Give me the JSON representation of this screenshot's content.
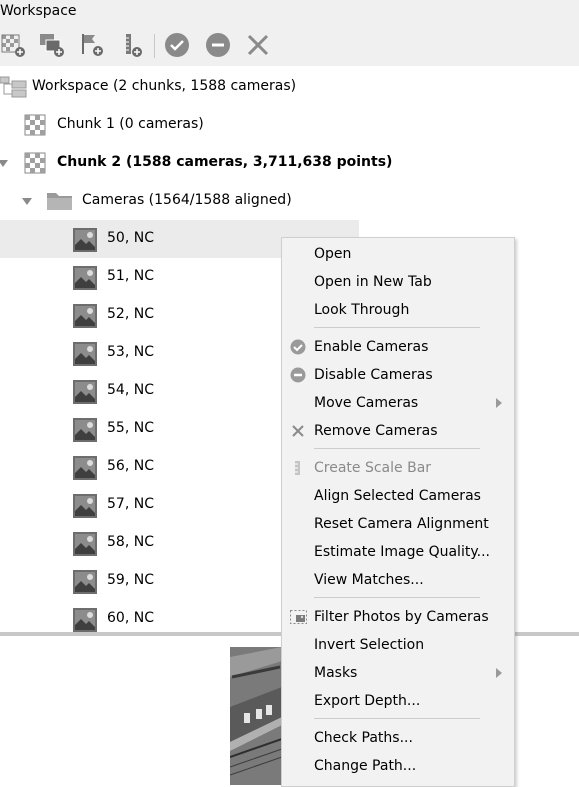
{
  "panel": {
    "title": "Workspace"
  },
  "toolbar": {
    "buttons": [
      {
        "icon": "add-chunk-icon"
      },
      {
        "icon": "add-photos-icon"
      },
      {
        "icon": "add-markers-icon"
      },
      {
        "icon": "add-scalebar-icon"
      },
      {
        "icon": "enable-check-icon"
      },
      {
        "icon": "disable-minus-icon"
      },
      {
        "icon": "remove-x-icon"
      }
    ]
  },
  "tree": {
    "workspace": "Workspace (2 chunks, 1588 cameras)",
    "chunk1": "Chunk 1 (0 cameras)",
    "chunk2": "Chunk 2 (1588 cameras, 3,711,638 points)",
    "cameras_folder": "Cameras (1564/1588 aligned)",
    "cameras": [
      "50, NC",
      "51, NC",
      "52, NC",
      "53, NC",
      "54, NC",
      "55, NC",
      "56, NC",
      "57, NC",
      "58, NC",
      "59, NC",
      "60, NC"
    ]
  },
  "context_menu": {
    "open": "Open",
    "open_new_tab": "Open in New Tab",
    "look_through": "Look Through",
    "enable_cameras": "Enable Cameras",
    "disable_cameras": "Disable Cameras",
    "move_cameras": "Move Cameras",
    "remove_cameras": "Remove Cameras",
    "create_scale_bar": "Create Scale Bar",
    "align_selected": "Align Selected Cameras",
    "reset_alignment": "Reset Camera Alignment",
    "estimate_quality": "Estimate Image Quality...",
    "view_matches": "View Matches...",
    "filter_photos": "Filter Photos by Cameras",
    "invert_selection": "Invert Selection",
    "masks": "Masks",
    "export_depth": "Export Depth...",
    "check_paths": "Check Paths...",
    "change_path": "Change Path..."
  },
  "colors": {
    "menu_bg": "#f2f2f2",
    "selection": "#ebebeb",
    "toolbar_bg": "#f0f0f0"
  }
}
